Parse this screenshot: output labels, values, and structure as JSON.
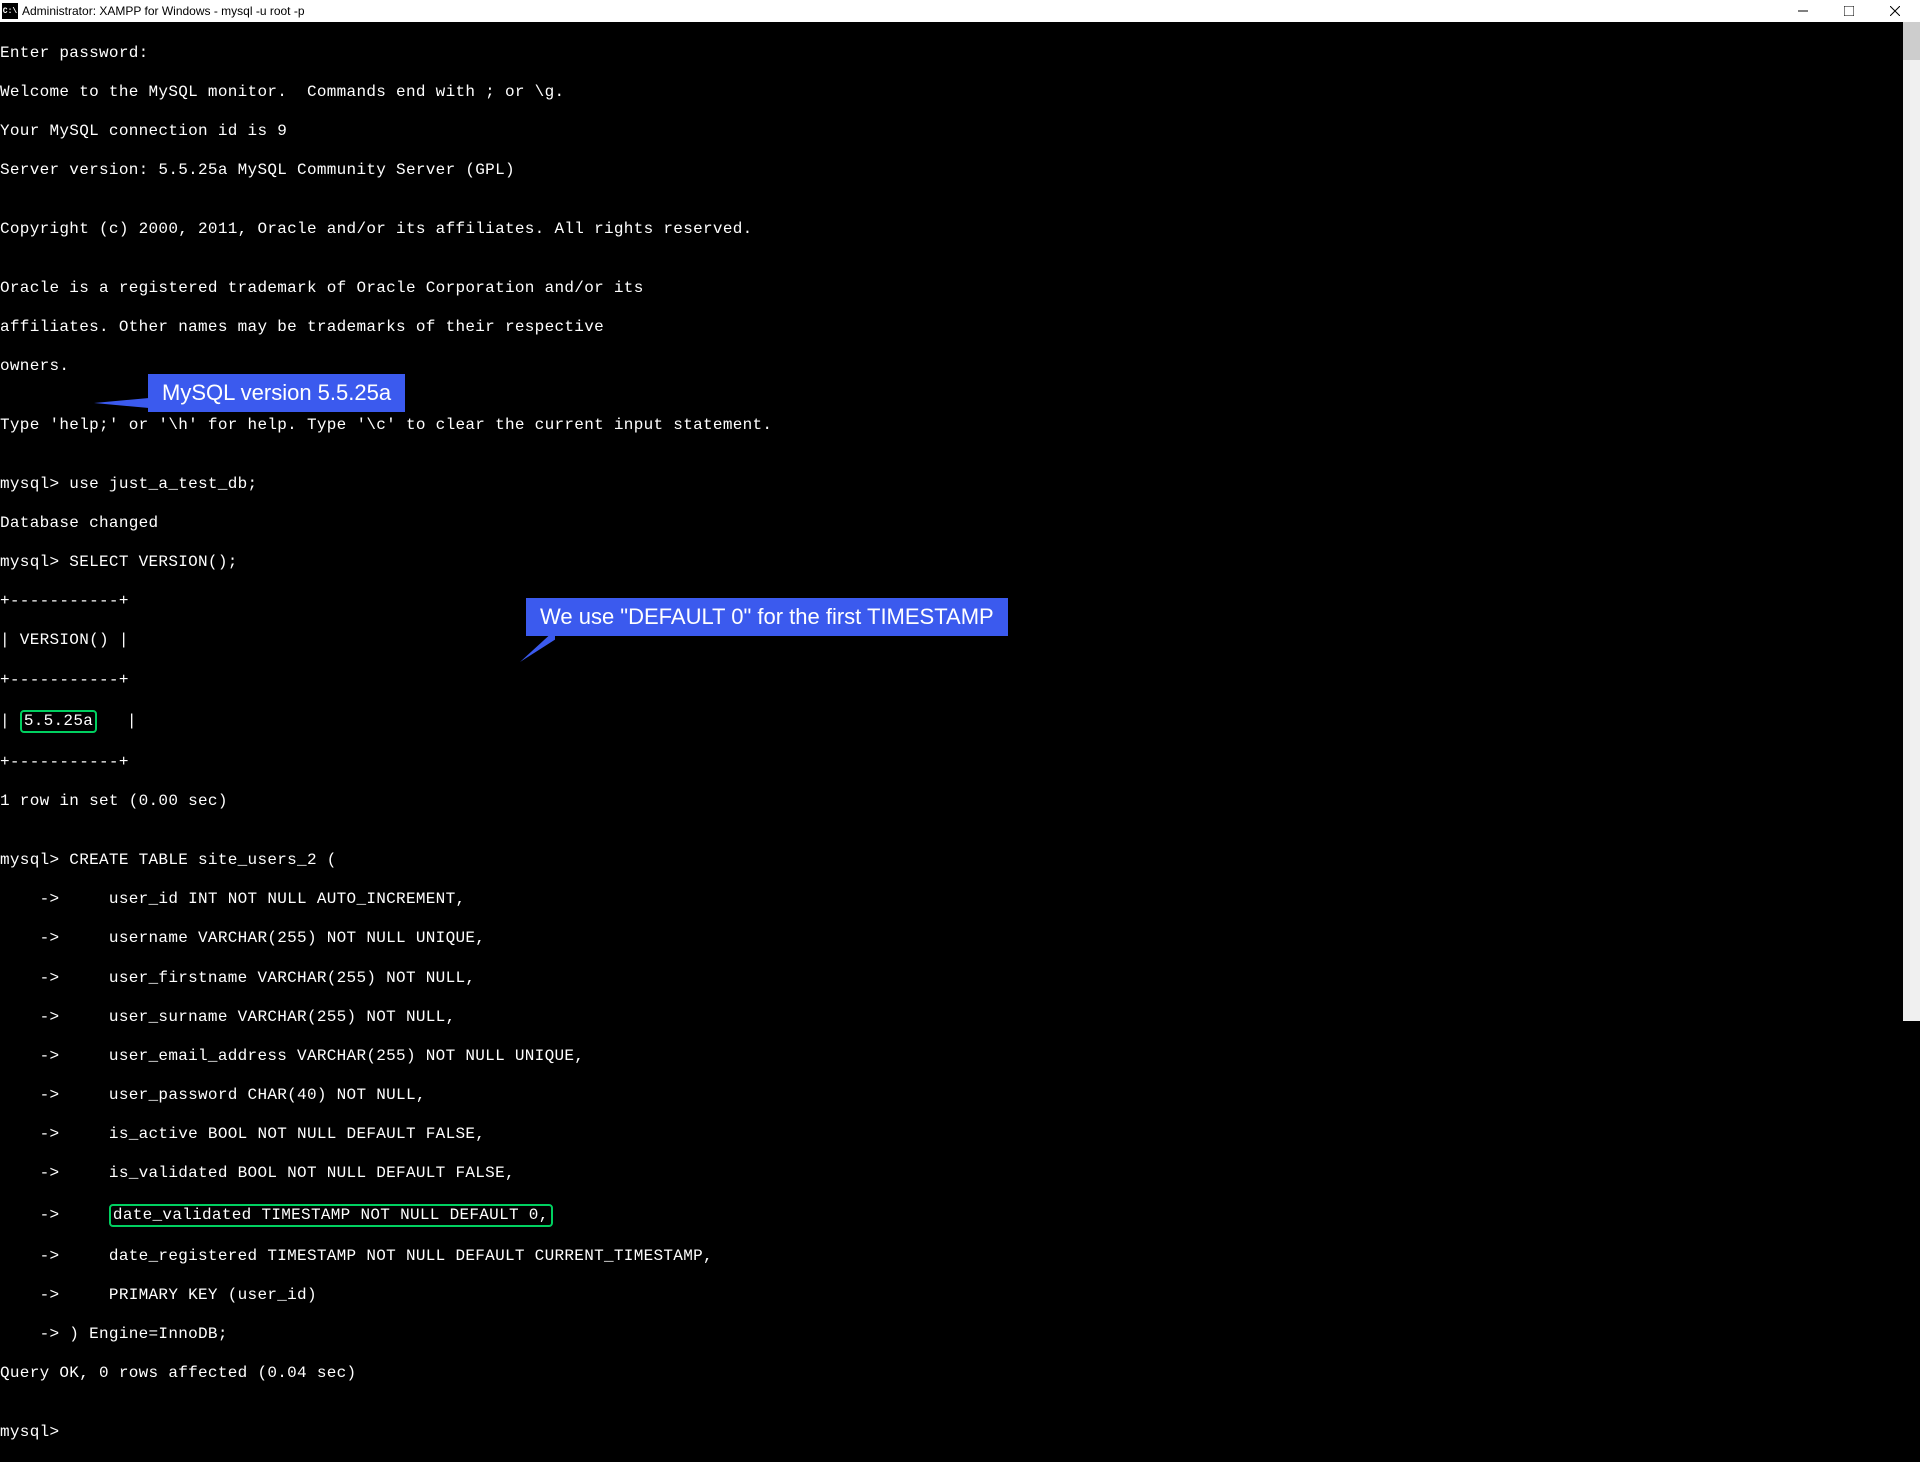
{
  "window": {
    "title": "Administrator: XAMPP for Windows - mysql  -u root -p",
    "icon_label": "C:\\"
  },
  "terminal": {
    "l1": "Enter password:",
    "l2": "Welcome to the MySQL monitor.  Commands end with ; or \\g.",
    "l3": "Your MySQL connection id is 9",
    "l4": "Server version: 5.5.25a MySQL Community Server (GPL)",
    "l5": "",
    "l6": "Copyright (c) 2000, 2011, Oracle and/or its affiliates. All rights reserved.",
    "l7": "",
    "l8": "Oracle is a registered trademark of Oracle Corporation and/or its",
    "l9": "affiliates. Other names may be trademarks of their respective",
    "l10": "owners.",
    "l11": "",
    "l12": "Type 'help;' or '\\h' for help. Type '\\c' to clear the current input statement.",
    "l13": "",
    "l14": "mysql> use just_a_test_db;",
    "l15": "Database changed",
    "l16": "mysql> SELECT VERSION();",
    "l17": "+-----------+",
    "l18": "| VERSION() |",
    "l19": "+-----------+",
    "l20a": "| ",
    "l20b": "5.5.25a",
    "l20c": "   |",
    "l21": "+-----------+",
    "l22": "1 row in set (0.00 sec)",
    "l23": "",
    "l24": "mysql> CREATE TABLE site_users_2 (",
    "l25": "    ->     user_id INT NOT NULL AUTO_INCREMENT,",
    "l26": "    ->     username VARCHAR(255) NOT NULL UNIQUE,",
    "l27": "    ->     user_firstname VARCHAR(255) NOT NULL,",
    "l28": "    ->     user_surname VARCHAR(255) NOT NULL,",
    "l29": "    ->     user_email_address VARCHAR(255) NOT NULL UNIQUE,",
    "l30": "    ->     user_password CHAR(40) NOT NULL,",
    "l31": "    ->     is_active BOOL NOT NULL DEFAULT FALSE,",
    "l32": "    ->     is_validated BOOL NOT NULL DEFAULT FALSE,",
    "l33a": "    ->     ",
    "l33b": "date_validated TIMESTAMP NOT NULL DEFAULT 0,",
    "l34": "    ->     date_registered TIMESTAMP NOT NULL DEFAULT CURRENT_TIMESTAMP,",
    "l35": "    ->     PRIMARY KEY (user_id)",
    "l36": "    -> ) Engine=InnoDB;",
    "l37": "Query OK, 0 rows affected (0.04 sec)",
    "l38": "",
    "l39": "mysql>"
  },
  "callouts": {
    "c1": "MySQL version 5.5.25a",
    "c2": "We use \"DEFAULT 0\" for the first TIMESTAMP"
  }
}
